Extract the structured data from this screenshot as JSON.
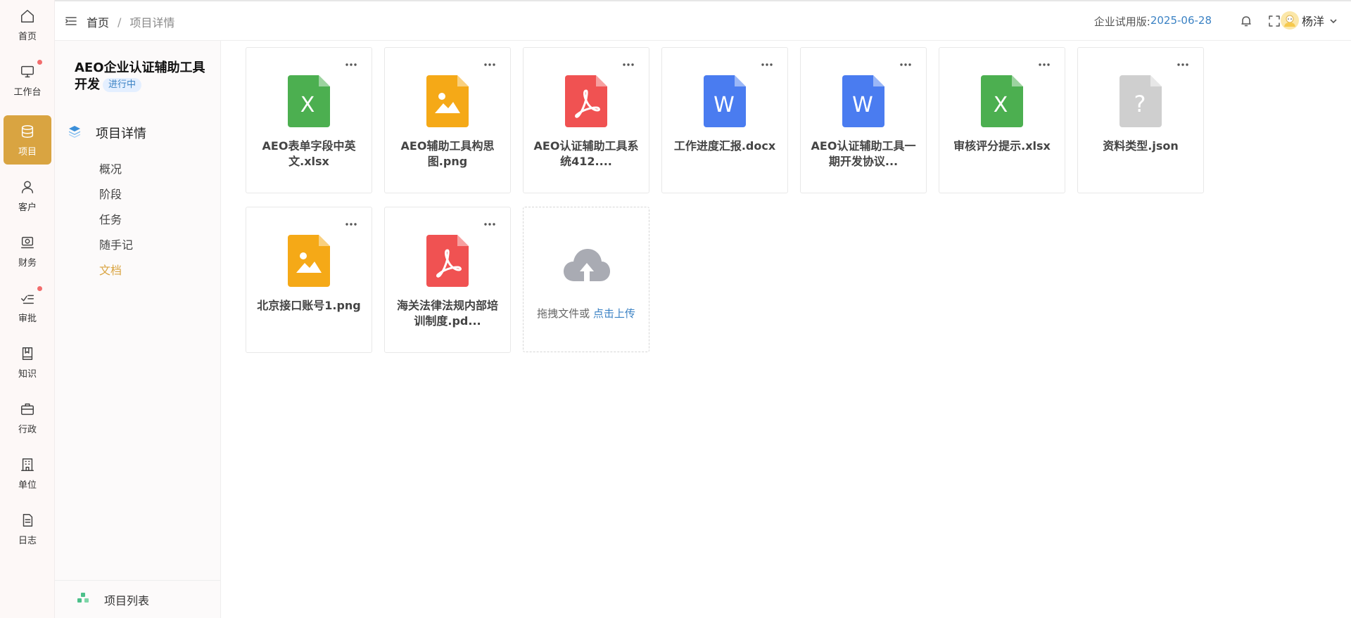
{
  "nav": {
    "items": [
      {
        "label": "首页",
        "icon": "home-icon"
      },
      {
        "label": "工作台",
        "icon": "monitor-icon",
        "dot": true
      },
      {
        "label": "项目",
        "icon": "database-icon",
        "active": true
      },
      {
        "label": "客户",
        "icon": "user-icon"
      },
      {
        "label": "财务",
        "icon": "finance-icon"
      },
      {
        "label": "审批",
        "icon": "approval-icon",
        "dot": true
      },
      {
        "label": "知识",
        "icon": "book-icon"
      },
      {
        "label": "行政",
        "icon": "briefcase-icon"
      },
      {
        "label": "单位",
        "icon": "building-icon"
      },
      {
        "label": "日志",
        "icon": "log-icon"
      }
    ]
  },
  "header": {
    "breadcrumb": {
      "home": "首页",
      "separator": "/",
      "current": "项目详情"
    },
    "trial_label": "企业试用版:",
    "trial_date": "2025-06-28",
    "user_name": "杨洋"
  },
  "project": {
    "title": "AEO企业认证辅助工具开发",
    "status": "进行中",
    "section_title": "项目详情",
    "sub_items": [
      "概况",
      "阶段",
      "任务",
      "随手记",
      "文档"
    ],
    "active_sub_item": "文档",
    "footer_label": "项目列表"
  },
  "files": [
    {
      "name": "AEO表单字段中英文.xlsx",
      "type": "excel-icon",
      "color": "#4caf50",
      "glyph": "X"
    },
    {
      "name": "AEO辅助工具构思图.png",
      "type": "image-icon",
      "color": "#f5a917",
      "glyph": ""
    },
    {
      "name": "AEO认证辅助工具系统412....",
      "type": "pdf-icon",
      "color": "#f05252",
      "glyph": ""
    },
    {
      "name": "工作进度汇报.docx",
      "type": "word-icon",
      "color": "#4a7cf0",
      "glyph": "W"
    },
    {
      "name": "AEO认证辅助工具一期开发协议...",
      "type": "word-icon",
      "color": "#4a7cf0",
      "glyph": "W"
    },
    {
      "name": "审核评分提示.xlsx",
      "type": "excel-icon",
      "color": "#4caf50",
      "glyph": "X"
    },
    {
      "name": "资料类型.json",
      "type": "unknown-file-icon",
      "color": "#cfcfcf",
      "glyph": "?"
    },
    {
      "name": "北京接口账号1.png",
      "type": "image-icon",
      "color": "#f5a917",
      "glyph": ""
    },
    {
      "name": "海关法律法规内部培训制度.pd...",
      "type": "pdf-icon",
      "color": "#f05252",
      "glyph": ""
    }
  ],
  "upload": {
    "text": "拖拽文件或",
    "link": "点击上传"
  },
  "colors": {
    "accent": "#d9a441",
    "link": "#3b82c4",
    "badge_bg": "#e4efff"
  }
}
